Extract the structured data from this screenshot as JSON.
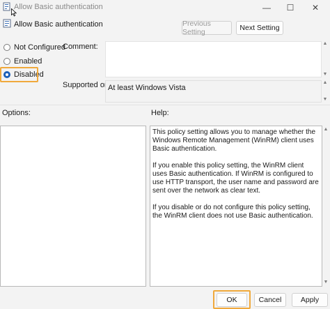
{
  "window": {
    "title": "Allow Basic authentication",
    "controls": {
      "minimize": "—",
      "maximize": "☐",
      "close": "✕"
    }
  },
  "policy": {
    "title": "Allow Basic authentication"
  },
  "nav": {
    "previous_label": "Previous Setting",
    "next_label": "Next Setting"
  },
  "state": {
    "options": [
      "Not Configured",
      "Enabled",
      "Disabled"
    ],
    "selected": "Disabled"
  },
  "comment": {
    "label": "Comment:",
    "value": ""
  },
  "supported": {
    "label": "Supported on:",
    "value": "At least Windows Vista"
  },
  "options_section": {
    "label": "Options:"
  },
  "help_section": {
    "label": "Help:",
    "paragraphs": [
      "This policy setting allows you to manage whether the Windows Remote Management (WinRM) client uses Basic authentication.",
      "If you enable this policy setting, the WinRM client uses Basic authentication. If WinRM is configured to use HTTP transport, the user name and password are sent over the network as clear text.",
      "If you disable or do not configure this policy setting, the WinRM client does not use Basic authentication."
    ]
  },
  "footer": {
    "ok_label": "OK",
    "cancel_label": "Cancel",
    "apply_label": "Apply"
  },
  "colors": {
    "highlight": "#f0a93c",
    "radio_accent": "#1d5fb8"
  }
}
